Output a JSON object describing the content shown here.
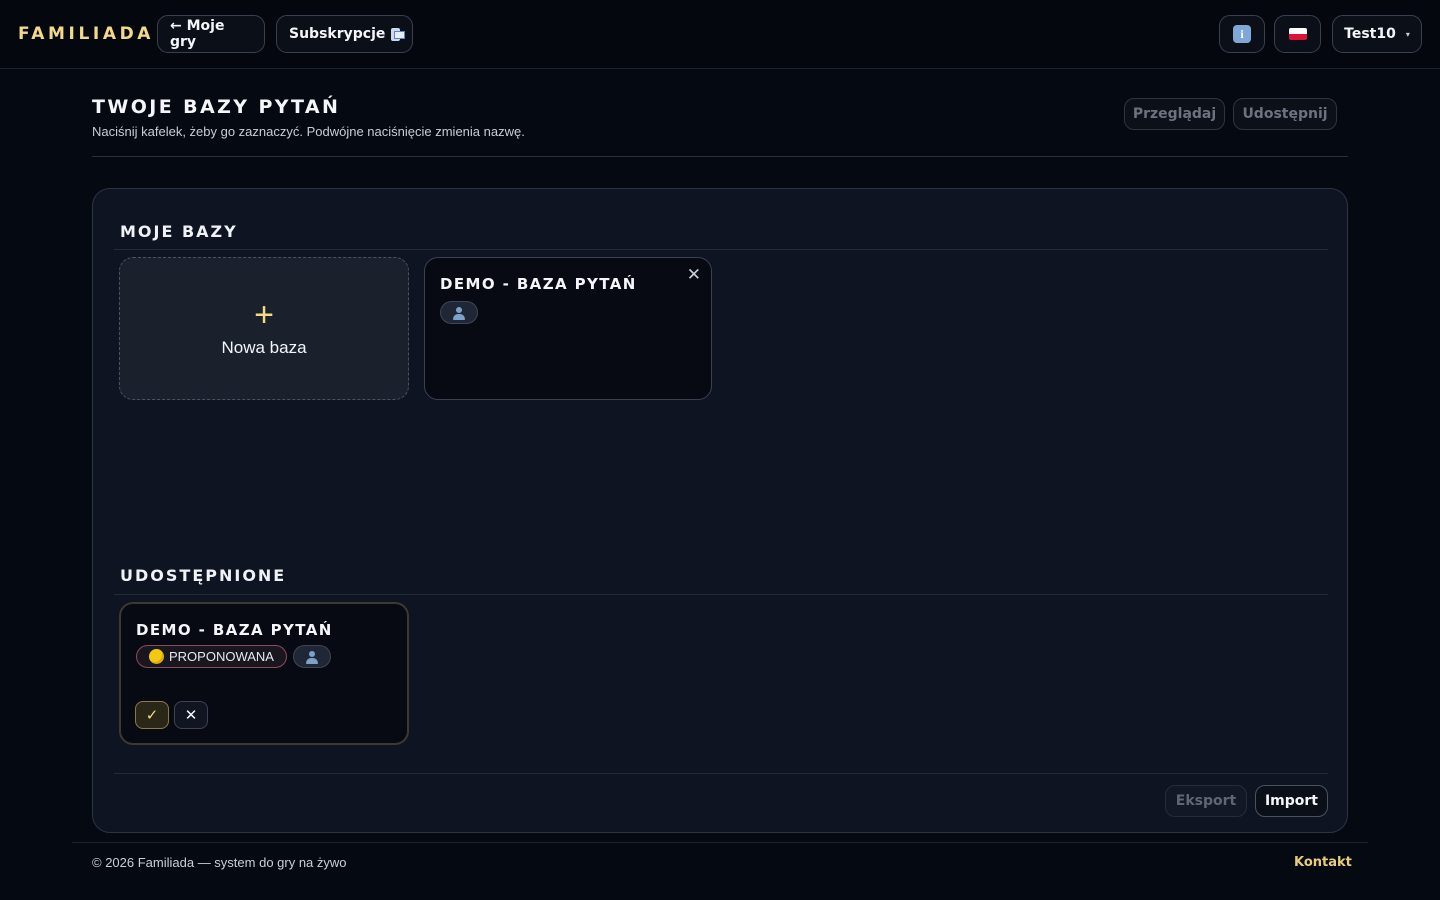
{
  "header": {
    "brand": "FAMILIADA",
    "back_label": "← Moje gry",
    "subscriptions_label": "Subskrypcje",
    "info_icon": "info-icon",
    "language_flag": "pl",
    "user_label": "Test10",
    "user_caret": "▾"
  },
  "page": {
    "title": "TWOJE BAZY PYTAŃ",
    "subtitle": "Naciśnij kafelek, żeby go zaznaczyć. Podwójne naciśnięcie zmienia nazwę.",
    "browse_label": "Przeglądaj",
    "share_label": "Udostępnij"
  },
  "my_bases": {
    "title": "MOJE BAZY",
    "new_tile": {
      "plus": "+",
      "label": "Nowa baza"
    },
    "items": [
      {
        "title": "DEMO - BAZA PYTAŃ",
        "close": "✕"
      }
    ]
  },
  "shared": {
    "title": "UDOSTĘPNIONE",
    "items": [
      {
        "title": "DEMO - BAZA PYTAŃ",
        "status": "PROPONOWANA",
        "accept": "✓",
        "reject": "✕"
      }
    ]
  },
  "panel_footer": {
    "export_label": "Eksport",
    "import_label": "Import"
  },
  "footer": {
    "copyright": "© 2026 Familiada — system do gry na żywo",
    "contact": "Kontakt"
  },
  "colors": {
    "accent": "#f3d98a",
    "background": "#050912",
    "panel": "#0e1422",
    "proposed_dot": "#f2c811"
  }
}
